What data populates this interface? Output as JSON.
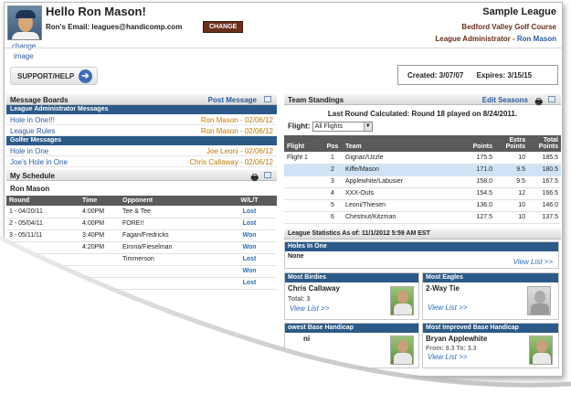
{
  "header": {
    "greeting": "Hello Ron Mason!",
    "email_label": "Ron's Email:",
    "email": "leagues@handicomp.com",
    "change_button": "CHANGE",
    "change_image_link_1": "change",
    "change_image_link_2": "image",
    "league_name": "Sample League",
    "course_name": "Bedford Valley Golf Course",
    "admin_label": "League Administrator -",
    "admin_name": "Ron Mason"
  },
  "support_button": "SUPPORT/HELP",
  "dates": {
    "created": "Created: 3/07/07",
    "expires": "Expires: 3/15/15"
  },
  "message_boards": {
    "title": "Message Boards",
    "post_link": "Post Message",
    "admin_header": "League Administrator Messages",
    "admin_messages": [
      {
        "title": "Hole in One!!!",
        "meta": "Ron Mason - 02/06/12"
      },
      {
        "title": "League Rules",
        "meta": "Ron Mason - 02/06/12"
      }
    ],
    "golfer_header": "Golfer Messages",
    "golfer_messages": [
      {
        "title": "Hole in One",
        "meta": "Joe Leoni - 02/06/12"
      },
      {
        "title": "Joe's Hole in One",
        "meta": "Chris Callaway - 02/06/12"
      }
    ]
  },
  "schedule": {
    "title": "My Schedule",
    "player": "Ron Mason",
    "columns": [
      "Round",
      "Time",
      "Opponent",
      "W/L/T"
    ],
    "rows": [
      {
        "round": "1 - 04/20/11",
        "time": "4:00PM",
        "opponent": "Tee & Tee",
        "result": "Lost"
      },
      {
        "round": "2 - 05/04/11",
        "time": "4:00PM",
        "opponent": "FORE!!",
        "result": "Lost"
      },
      {
        "round": "3 - 05/11/11",
        "time": "3:40PM",
        "opponent": "Fagan/Fredricks",
        "result": "Won"
      },
      {
        "round": "",
        "time": "4:20PM",
        "opponent": "Eirona/Fieselman",
        "result": "Won"
      },
      {
        "round": "",
        "time": "",
        "opponent": "Timmerson",
        "result": "Lost"
      },
      {
        "round": "",
        "time": "",
        "opponent": "",
        "result": "Won"
      },
      {
        "round": "",
        "time": "",
        "opponent": "",
        "result": "Lost"
      }
    ]
  },
  "standings": {
    "title": "Team Standings",
    "edit_link": "Edit Seasons",
    "last_round": "Last Round Calculated: Round 18 played on 8/24/2011.",
    "flight_label": "Flight:",
    "flight_value": "All Flights",
    "columns": [
      "Flight",
      "Pos",
      "Team",
      "Points",
      "Extra Points",
      "Total Points"
    ],
    "rows": [
      {
        "flight": "Flight 1",
        "pos": "1",
        "team": "Gignac/Uzzle",
        "points": "175.5",
        "extra": "10",
        "total": "185.5"
      },
      {
        "flight": "",
        "pos": "2",
        "team": "Kiffe/Mason",
        "points": "171.0",
        "extra": "9.5",
        "total": "180.5"
      },
      {
        "flight": "",
        "pos": "3",
        "team": "Applewhite/Labusier",
        "points": "158.0",
        "extra": "9.5",
        "total": "167.5"
      },
      {
        "flight": "",
        "pos": "4",
        "team": "XXX-Outs",
        "points": "154.5",
        "extra": "12",
        "total": "166.5"
      },
      {
        "flight": "",
        "pos": "5",
        "team": "Leoni/Thiesen",
        "points": "136.0",
        "extra": "10",
        "total": "146.0"
      },
      {
        "flight": "",
        "pos": "6",
        "team": "Chestnut/Kitzman",
        "points": "127.5",
        "extra": "10",
        "total": "137.5"
      }
    ]
  },
  "stats": {
    "title": "League Statistics As of: 11/1/2012 5:59 AM EST",
    "holes_in_one": {
      "title": "Holes In One",
      "value": "None",
      "link": "View List >>"
    },
    "most_birdies": {
      "title": "Most Birdies",
      "name": "Chris Callaway",
      "total": "Total: 3",
      "link": "View List >>"
    },
    "most_eagles": {
      "title": "Most Eagles",
      "name": "2-Way Tie",
      "link": "View List >>"
    },
    "lowest_base": {
      "title": "owest Base Handicap",
      "name": "ni"
    },
    "most_improved": {
      "title": "Most Improved Base Handicap",
      "name": "Bryan Applewhite",
      "from_to": "From: 9.3  To: 3.3",
      "link": "View List >>"
    }
  },
  "colors": {
    "accent": "#2c5a88",
    "link": "#2a6db8",
    "meta": "#c47a00",
    "change": "#6b2f1a"
  }
}
